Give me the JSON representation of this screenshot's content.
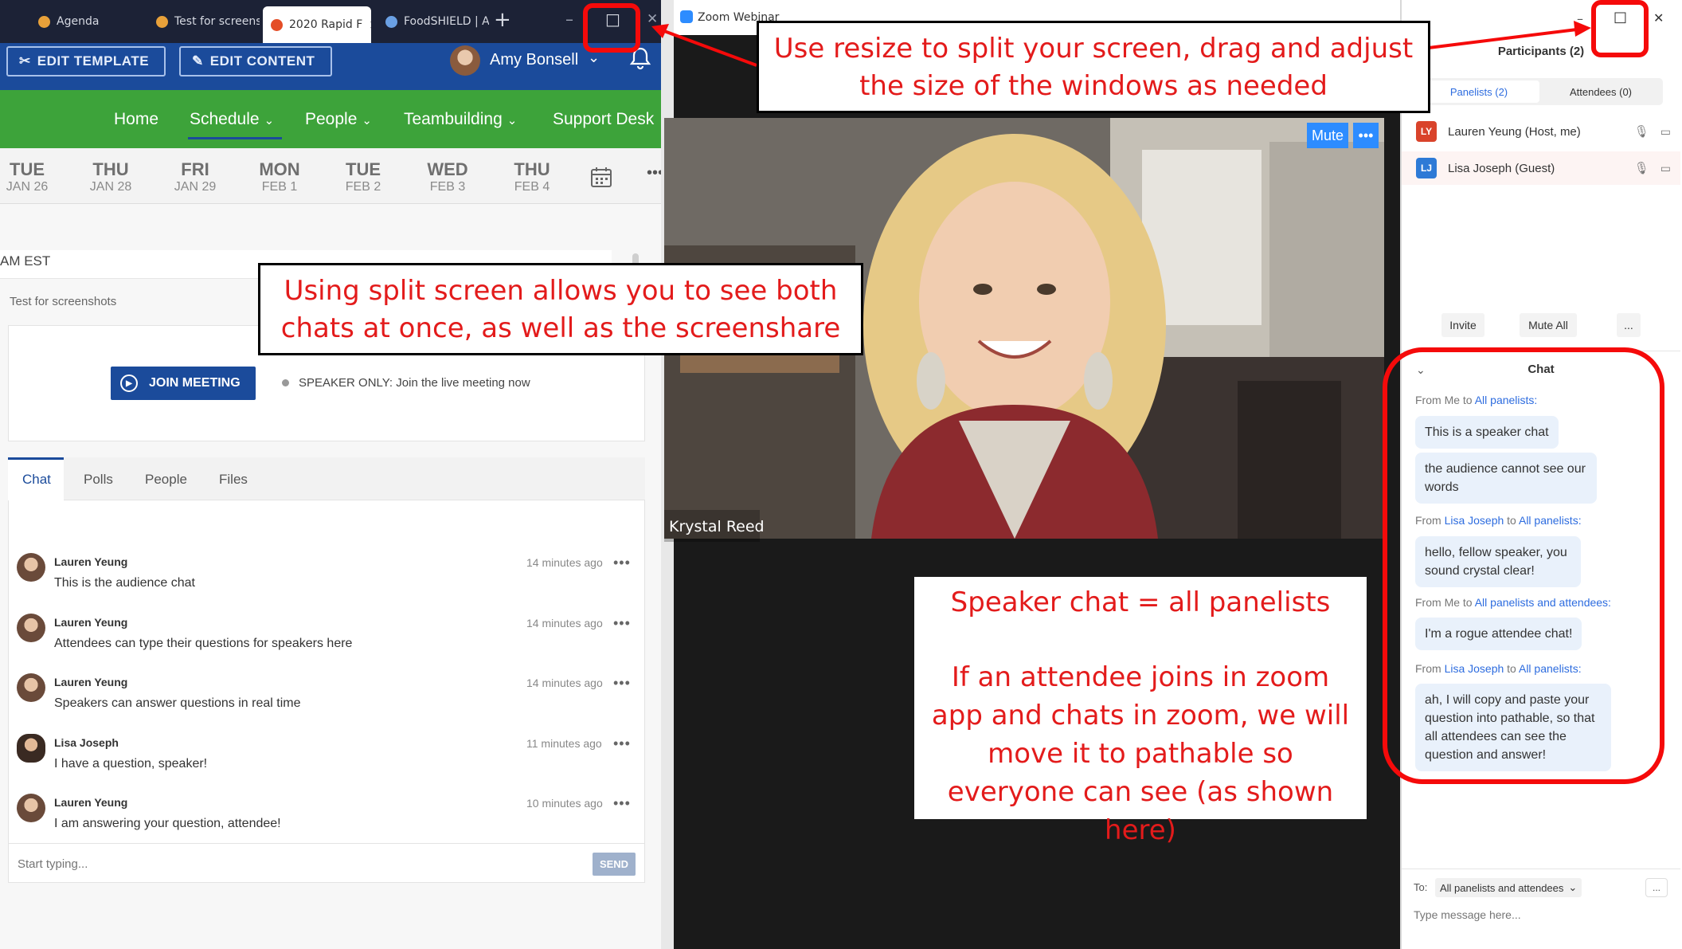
{
  "browser": {
    "tabs": [
      {
        "label": "Agenda",
        "color": "#e8a13a"
      },
      {
        "label": "Test for screensh",
        "color": "#e8a13a"
      },
      {
        "label": "2020 Rapid F",
        "color": "#e44d26"
      },
      {
        "label": "FoodSHIELD | Ap",
        "color": "#6aa0e4"
      }
    ],
    "new_tab_glyph": "+",
    "window_controls": {
      "minimize": "–",
      "maximize": "□",
      "close": "✕"
    }
  },
  "app": {
    "edit_template_label": "EDIT TEMPLATE",
    "edit_content_label": "EDIT CONTENT",
    "user_name": "Amy Bonsell",
    "nav": [
      {
        "label": "Home"
      },
      {
        "label": "Schedule",
        "has_dropdown": true,
        "active": true
      },
      {
        "label": "People",
        "has_dropdown": true
      },
      {
        "label": "Teambuilding",
        "has_dropdown": true
      },
      {
        "label": "Support Desk"
      }
    ],
    "dates": [
      {
        "day": "TUE",
        "date": "JAN 26"
      },
      {
        "day": "THU",
        "date": "JAN 28"
      },
      {
        "day": "FRI",
        "date": "JAN 29"
      },
      {
        "day": "MON",
        "date": "FEB 1"
      },
      {
        "day": "TUE",
        "date": "FEB 2"
      },
      {
        "day": "WED",
        "date": "FEB 3"
      },
      {
        "day": "THU",
        "date": "FEB 4"
      }
    ],
    "more_glyph": "•••",
    "time_label": "AM EST",
    "session_title": "Test for screenshots",
    "join_label": "JOIN MEETING",
    "speaker_note": "SPEAKER ONLY: Join the live meeting now",
    "chat_tabs": [
      "Chat",
      "Polls",
      "People",
      "Files"
    ],
    "messages": [
      {
        "name": "Lauren Yeung",
        "text": "This is the audience chat",
        "time": "14 minutes ago"
      },
      {
        "name": "Lauren Yeung",
        "text": "Attendees can type their questions for speakers here",
        "time": "14 minutes ago"
      },
      {
        "name": "Lauren Yeung",
        "text": "Speakers can answer questions in real time",
        "time": "14 minutes ago"
      },
      {
        "name": "Lisa Joseph",
        "text": "I have a question, speaker!",
        "time": "11 minutes ago"
      },
      {
        "name": "Lauren Yeung",
        "text": "I am answering your question, attendee!",
        "time": "10 minutes ago"
      }
    ],
    "message_more": "•••",
    "input_placeholder": "Start typing...",
    "send_label": "SEND"
  },
  "zoom": {
    "window_title": "Zoom Webinar",
    "mute_label": "Mute",
    "more_label": "•••",
    "speaker_name": "Krystal Reed",
    "participants_title": "Participants (2)",
    "tab_panelists": "Panelists (2)",
    "tab_attendees": "Attendees (0)",
    "participants": [
      {
        "initials": "LY",
        "name": "Lauren Yeung (Host, me)",
        "color": "#d9432b"
      },
      {
        "initials": "LJ",
        "name": "Lisa Joseph (Guest)",
        "color": "#2d7ad6"
      }
    ],
    "invite_label": "Invite",
    "mute_all_label": "Mute All",
    "more_small": "...",
    "chat_title": "Chat",
    "chat": [
      {
        "from": "Me",
        "to": "All panelists:",
        "bubbles": [
          "This is a speaker chat",
          "the audience cannot see our words"
        ]
      },
      {
        "from": "Lisa Joseph",
        "to": "All panelists:",
        "bubbles": [
          "hello, fellow speaker, you sound crystal clear!"
        ]
      },
      {
        "from": "Me",
        "to": "All panelists and attendees:",
        "bubbles": [
          "I'm a rogue attendee chat!"
        ]
      },
      {
        "from": "Lisa Joseph",
        "to": "All panelists:",
        "bubbles": [
          "ah, I will copy and paste your question into pathable, so that all attendees can see the question and answer!"
        ]
      }
    ],
    "from_word": "From",
    "to_word": "to",
    "to_label": "To:",
    "to_value": "All panelists and attendees",
    "message_placeholder": "Type message here..."
  },
  "annotations": {
    "resize": "Use resize to split your screen, drag and adjust the size of the windows as needed",
    "split": "Using split screen allows you to see both chats at once, as well as the screenshare",
    "speaker_chat": "Speaker chat = all panelists",
    "attendee_note": "If an attendee joins in zoom app and chats in zoom, we will move it to pathable so everyone can see (as shown here)"
  },
  "colors": {
    "annotation_red": "#f50a0a",
    "app_blue": "#1b4b9b",
    "nav_green": "#3da33a",
    "zoom_blue": "#2d8cff"
  }
}
